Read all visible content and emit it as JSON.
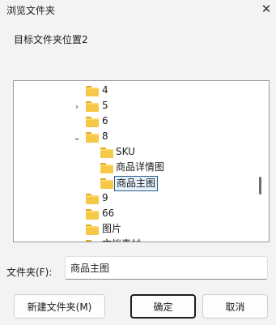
{
  "window": {
    "title": "浏览文件夹",
    "close_glyph": "✕"
  },
  "dialog": {
    "subtitle": "目标文件夹位置2"
  },
  "tree": {
    "items": [
      {
        "label": "4",
        "arrow": "",
        "depth": 1,
        "selected": false
      },
      {
        "label": "5",
        "arrow": "›",
        "depth": 1,
        "selected": false
      },
      {
        "label": "6",
        "arrow": "",
        "depth": 1,
        "selected": false
      },
      {
        "label": "8",
        "arrow": "⌄",
        "depth": 1,
        "selected": false
      },
      {
        "label": "SKU",
        "arrow": "",
        "depth": 2,
        "selected": false
      },
      {
        "label": "商品详情图",
        "arrow": "",
        "depth": 2,
        "selected": false
      },
      {
        "label": "商品主图",
        "arrow": "",
        "depth": 2,
        "selected": true
      },
      {
        "label": "9",
        "arrow": "",
        "depth": 1,
        "selected": false
      },
      {
        "label": "66",
        "arrow": "",
        "depth": 1,
        "selected": false
      },
      {
        "label": "图片",
        "arrow": "",
        "depth": 1,
        "selected": false
      },
      {
        "label": "文档素材",
        "arrow": "›",
        "depth": 1,
        "selected": false
      }
    ]
  },
  "folder_field": {
    "label": "文件夹(F):",
    "value": "商品主图"
  },
  "buttons": {
    "new_folder": "新建文件夹(M)",
    "ok": "确定",
    "cancel": "取消"
  },
  "colors": {
    "folder": "#f5c848",
    "selection_border": "#2c5b8a",
    "selection_fill": "#e5f1fb"
  }
}
